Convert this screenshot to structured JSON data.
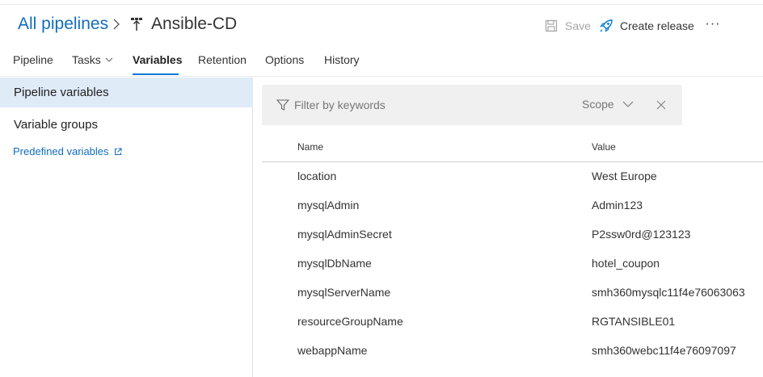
{
  "breadcrumb": {
    "parent": "All pipelines",
    "title": "Ansible-CD"
  },
  "toolbar": {
    "save_label": "Save",
    "create_release_label": "Create release",
    "more_label": "···"
  },
  "tabs": [
    {
      "label": "Pipeline"
    },
    {
      "label": "Tasks"
    },
    {
      "label": "Variables"
    },
    {
      "label": "Retention"
    },
    {
      "label": "Options"
    },
    {
      "label": "History"
    }
  ],
  "active_tab": "Variables",
  "sidebar": {
    "items": [
      {
        "label": "Pipeline variables"
      },
      {
        "label": "Variable groups"
      }
    ],
    "predefined_link": "Predefined variables"
  },
  "filter": {
    "placeholder": "Filter by keywords",
    "scope_label": "Scope"
  },
  "table": {
    "headers": {
      "name": "Name",
      "value": "Value"
    },
    "rows": [
      {
        "name": "location",
        "value": "West Europe"
      },
      {
        "name": "mysqlAdmin",
        "value": "Admin123"
      },
      {
        "name": "mysqlAdminSecret",
        "value": "P2ssw0rd@123123"
      },
      {
        "name": "mysqlDbName",
        "value": "hotel_coupon"
      },
      {
        "name": "mysqlServerName",
        "value": "smh360mysqlc11f4e76063063"
      },
      {
        "name": "resourceGroupName",
        "value": "RGTANSIBLE01"
      },
      {
        "name": "webappName",
        "value": "smh360webc11f4e76097097"
      }
    ]
  },
  "colors": {
    "accent": "#0078d4",
    "link": "#106ebe",
    "selected_bg": "#dfebf7",
    "filter_bg": "#f0f0f0"
  }
}
